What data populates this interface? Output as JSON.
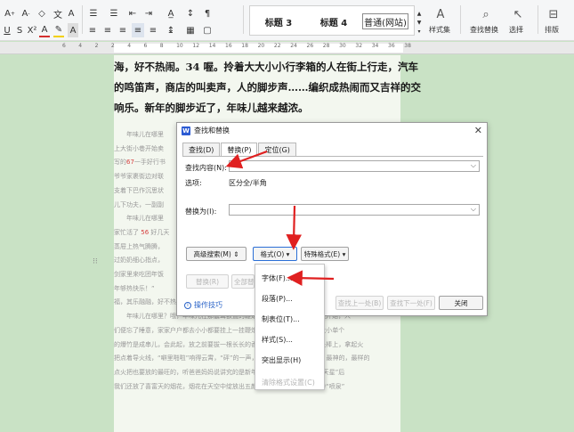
{
  "ribbon": {
    "styles": {
      "heading3": "标题 3",
      "heading4": "标题 4",
      "normal_web": "普通(网站)"
    },
    "style_set_label": "样式集",
    "find_replace_label": "查找替换",
    "select_label": "选择",
    "layout_label": "排版"
  },
  "ruler": {
    "ticks": [
      "6",
      "4",
      "2",
      "2",
      "4",
      "6",
      "8",
      "10",
      "12",
      "14",
      "16",
      "18",
      "20",
      "22",
      "24",
      "26",
      "28",
      "30",
      "32",
      "34",
      "36",
      "38"
    ]
  },
  "document": {
    "headings": [
      "海，好不热闹。34 喔。拎着大大小小行李箱的人在街上行走，汽车",
      "的鸣笛声，商店的叫卖声，人的脚步声……编织成热闹而又吉祥的交",
      "响乐。新年的脚步近了，年味儿越来越浓。"
    ],
    "body": [
      {
        "pre": "　　年味儿在哪里",
        "red": "",
        "post": ""
      },
      {
        "pre": "上大街小巷开始卖",
        "red": "",
        "post": ""
      },
      {
        "pre": "写的",
        "red": "67",
        "post": "一手好行书"
      },
      {
        "pre": "爷爷家裹街边对联",
        "red": "",
        "post": ""
      },
      {
        "pre": "支着下巴作沉思状",
        "red": "",
        "post": ""
      },
      {
        "pre": "儿下功夫，一副副",
        "red": "",
        "post": ""
      },
      {
        "pre": "　　年味儿在哪里",
        "red": "",
        "post": ""
      },
      {
        "pre": "家忙活了 ",
        "red": "56",
        "post": " 好几天"
      },
      {
        "pre": "蒸屉上热气腾腾，",
        "red": "",
        "post": ""
      },
      {
        "pre": "过奶奶细心指点，",
        "red": "",
        "post": ""
      },
      {
        "pre": "剑家里来吃团年饭",
        "red": "",
        "post": ""
      },
      {
        "pre": "年够热快乐！”",
        "red": "",
        "post": ""
      },
      {
        "pre": "福，其乐融融，好不热闹。",
        "red": "",
        "post": ""
      },
      {
        "pre": "　　年味儿在哪里？哦，年味儿在那震耳欲聋的鞭炮声里。从新年第一天零点开始，人",
        "red": "",
        "post": ""
      },
      {
        "pre": "们便忘了睡意，家家户户都去小小都要挂上一挂鞭炮，来赶一赶“岩天富”。大小单个",
        "red": "",
        "post": ""
      },
      {
        "pre": "的爆竹是成串儿，会此起，放之前要拔一根长长的香，放在门口，香“扒”在长棒上，拿起火",
        "red": "",
        "post": ""
      },
      {
        "pre": "把点着导火线，“噼里啪啦”响得云霄，“砰”的一声，我像把最大的一串天窗，最神的，最样的",
        "red": "",
        "post": ""
      },
      {
        "pre": "点火把也要放的最旺的，听爸爸妈妈说讲究的是新年红红火火的好兆头。“出天星”后",
        "red": "",
        "post": ""
      },
      {
        "pre": "我们还放了喜富天的烟花，烟花在天空中绽放出五颜六色的花朵，还有旋转中“喷泉”",
        "red": "",
        "post": ""
      }
    ]
  },
  "dialog": {
    "title": "查找和替换",
    "tabs": [
      "查找(D)",
      "替换(P)",
      "定位(G)"
    ],
    "find_label": "查找内容(N):",
    "find_value": "",
    "options_label": "选项:",
    "options_value": "区分全/半角",
    "replace_label": "替换为(I):",
    "replace_value": "",
    "buttons": {
      "advanced": "高级搜索(M) ⇕",
      "format": "格式(O) ▾",
      "special": "特殊格式(E) ▾",
      "replace": "替换(R)",
      "replace_all": "全部替换(A)",
      "find_prev": "查找上一处(B)",
      "find_next": "查找下一处(F)",
      "close": "关闭"
    },
    "tips_link": "操作技巧"
  },
  "format_menu": {
    "items": [
      {
        "label": "字体(F)...",
        "enabled": true
      },
      {
        "label": "段落(P)...",
        "enabled": true
      },
      {
        "label": "制表位(T)...",
        "enabled": true
      },
      {
        "label": "样式(S)...",
        "enabled": true
      },
      {
        "label": "突出显示(H)",
        "enabled": true
      },
      {
        "label": "清除格式设置(C)",
        "enabled": false
      }
    ]
  },
  "colors": {
    "annotation_arrow": "#e02020",
    "page_bg": "#c9e2c5",
    "link": "#2b64c8",
    "font_red": "#d64040"
  }
}
